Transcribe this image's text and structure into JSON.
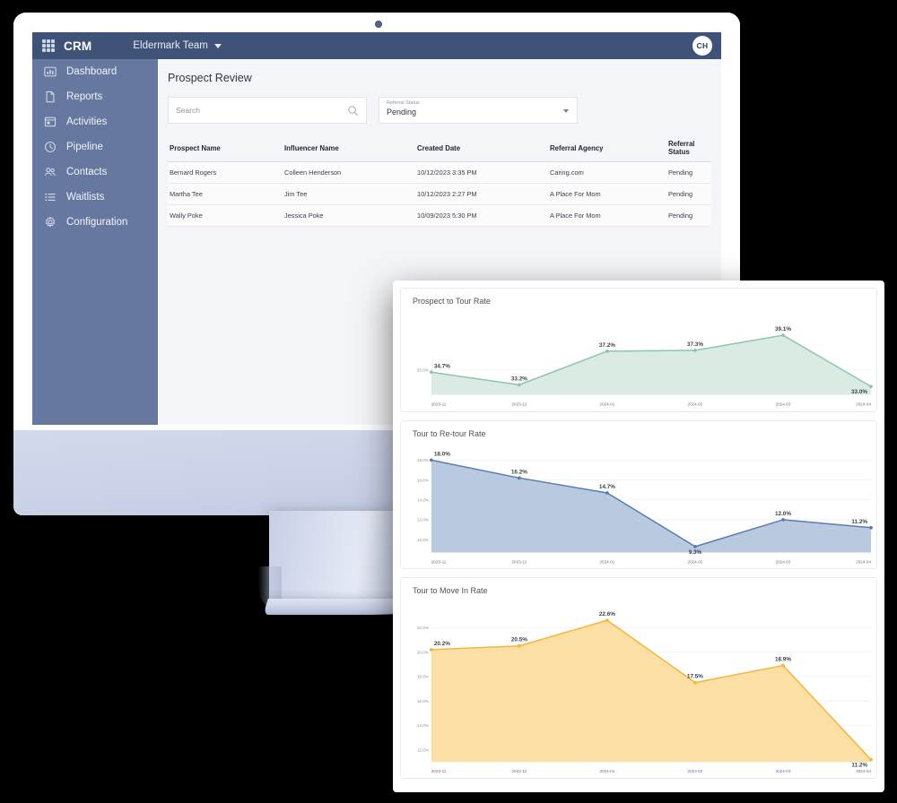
{
  "app": {
    "brand": "CRM",
    "team": "Eldermark Team",
    "avatar_initials": "CH",
    "apps_icon": "grid-icon",
    "team_chevron_icon": "chevron-down-icon"
  },
  "sidebar": {
    "items": [
      {
        "label": "Dashboard",
        "icon": "bar-chart-icon"
      },
      {
        "label": "Reports",
        "icon": "document-icon"
      },
      {
        "label": "Activities",
        "icon": "calendar-window-icon"
      },
      {
        "label": "Pipeline",
        "icon": "clock-icon"
      },
      {
        "label": "Contacts",
        "icon": "people-icon"
      },
      {
        "label": "Waitlists",
        "icon": "list-icon"
      },
      {
        "label": "Configuration",
        "icon": "gear-icon"
      }
    ]
  },
  "main": {
    "page_title": "Prospect Review",
    "search": {
      "placeholder": "Search",
      "value": "",
      "icon": "search-icon"
    },
    "status_filter": {
      "label": "Referral Status",
      "value": "Pending",
      "icon": "chevron-down-icon"
    },
    "table": {
      "columns": [
        "Prospect Name",
        "Influencer Name",
        "Created Date",
        "Referral Agency",
        "Referral Status"
      ],
      "rows": [
        [
          "Bernard Rogers",
          "Colleen Henderson",
          "10/12/2023 3:35 PM",
          "Caring.com",
          "Pending"
        ],
        [
          "Martha Tee",
          "Jim Tee",
          "10/12/2023 2:27 PM",
          "A Place For Mom",
          "Pending"
        ],
        [
          "Wally Poke",
          "Jessica Poke",
          "10/09/2023 5:30 PM",
          "A Place For Mom",
          "Pending"
        ]
      ]
    }
  },
  "colors": {
    "header": "#3f5378",
    "sidebar": "#6778a0",
    "chart_green_line": "#8fc4ad",
    "chart_green_fill": "#d9ebe3",
    "chart_blue_line": "#5b7cb0",
    "chart_blue_fill": "#b9c9e0",
    "chart_orange_line": "#f5b63f",
    "chart_orange_fill": "#fbdfa4"
  },
  "chart_data": [
    {
      "type": "area",
      "title": "Prospect to Tour Rate",
      "categories": [
        "2023-11",
        "2023-12",
        "2024-01",
        "2024-02",
        "2024-03",
        "2024-04"
      ],
      "values": [
        34.7,
        33.2,
        37.2,
        37.3,
        39.1,
        33.0
      ],
      "labels": [
        "34.7%",
        "33.2%",
        "37.2%",
        "37.3%",
        "39.1%",
        "33.0%"
      ],
      "yticks": [
        35.0
      ],
      "ytick_labels": [
        "35.0%"
      ],
      "ylim": [
        32.0,
        40.5
      ],
      "xlabel": "",
      "ylabel": "",
      "grid": true,
      "legend": "none",
      "color": "#8fc4ad",
      "fill": "#d9ebe3"
    },
    {
      "type": "area",
      "title": "Tour to Re-tour Rate",
      "categories": [
        "2023-11",
        "2023-12",
        "2024-01",
        "2024-02",
        "2024-03",
        "2024-04"
      ],
      "values": [
        18.0,
        16.2,
        14.7,
        9.3,
        12.0,
        11.2
      ],
      "labels": [
        "18.0%",
        "16.2%",
        "14.7%",
        "9.3%",
        "12.0%",
        "11.2%"
      ],
      "yticks": [
        18.0,
        16.0,
        14.0,
        12.0,
        10.0
      ],
      "ytick_labels": [
        "18.0%",
        "16.0%",
        "14.0%",
        "12.0%",
        "10.0%"
      ],
      "ylim": [
        8.7,
        18.4
      ],
      "xlabel": "",
      "ylabel": "",
      "grid": true,
      "legend": "none",
      "color": "#5b7cb0",
      "fill": "#b9c9e0"
    },
    {
      "type": "area",
      "title": "Tour to Move In Rate",
      "categories": [
        "2023-11",
        "2023-12",
        "2024-01",
        "2024-02",
        "2024-03",
        "2024-04"
      ],
      "values": [
        20.2,
        20.5,
        22.6,
        17.5,
        18.9,
        11.2
      ],
      "labels": [
        "20.2%",
        "20.5%",
        "22.6%",
        "17.5%",
        "18.9%",
        "11.2%"
      ],
      "yticks": [
        22.0,
        20.0,
        18.0,
        16.0,
        14.0,
        12.0
      ],
      "ytick_labels": [
        "22.0%",
        "20.0%",
        "18.0%",
        "16.0%",
        "14.0%",
        "12.0%"
      ],
      "ylim": [
        11.0,
        23.2
      ],
      "xlabel": "",
      "ylabel": "",
      "grid": true,
      "legend": "none",
      "color": "#f5b63f",
      "fill": "#fbdfa4"
    }
  ]
}
